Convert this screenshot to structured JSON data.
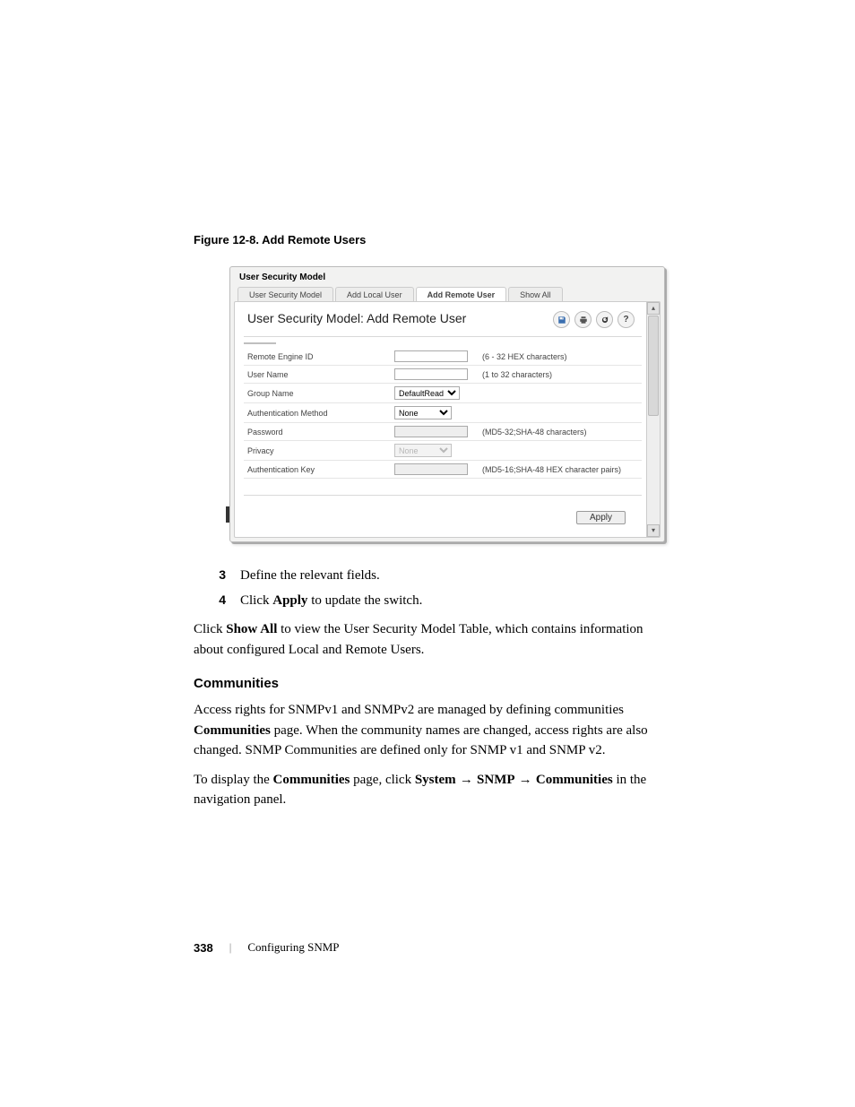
{
  "figure": {
    "caption": "Figure 12-8.    Add Remote Users"
  },
  "shot": {
    "title": "User Security Model",
    "tabs": [
      "User Security Model",
      "Add Local User",
      "Add Remote User",
      "Show All"
    ],
    "heading": "User Security Model: Add Remote User",
    "fields": {
      "remote_engine_id": {
        "label": "Remote Engine ID",
        "hint": "(6 - 32 HEX characters)"
      },
      "user_name": {
        "label": "User Name",
        "hint": "(1 to 32 characters)"
      },
      "group_name": {
        "label": "Group Name",
        "value": "DefaultRead"
      },
      "auth_method": {
        "label": "Authentication Method",
        "value": "None"
      },
      "password": {
        "label": "Password",
        "hint": "(MD5-32;SHA-48 characters)"
      },
      "privacy": {
        "label": "Privacy",
        "value": "None"
      },
      "auth_key": {
        "label": "Authentication Key",
        "hint": "(MD5-16;SHA-48 HEX character pairs)"
      }
    },
    "apply": "Apply"
  },
  "steps": {
    "s3_num": "3",
    "s3_text": "Define the relevant fields.",
    "s4_num": "4",
    "s4_pre": "Click ",
    "s4_bold": "Apply",
    "s4_post": " to update the switch."
  },
  "after_steps": {
    "pre": "Click ",
    "bold": "Show All",
    "post": " to view the User Security Model Table, which contains information about configured Local and Remote Users."
  },
  "communities": {
    "heading": "Communities",
    "p1_pre": "Access rights for SNMPv1 and SNMPv2 are managed by defining communities ",
    "p1_bold": "Communities",
    "p1_post": " page. When the community names are changed, access rights are also changed. SNMP Communities are defined only for SNMP v1 and SNMP v2.",
    "p2_pre": "To display the ",
    "p2_b1": "Communities",
    "p2_mid1": " page, click ",
    "p2_b2": "System",
    "p2_arr1": " → ",
    "p2_b3": "SNMP",
    "p2_arr2": " → ",
    "p2_b4": "Communities",
    "p2_post": " in the navigation panel."
  },
  "footer": {
    "page": "338",
    "sep": "|",
    "chapter": "Configuring SNMP"
  }
}
